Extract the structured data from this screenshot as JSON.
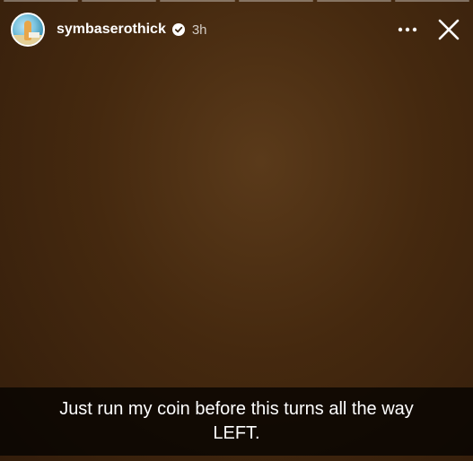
{
  "story": {
    "progress_segments_total": 6,
    "progress_segments_viewed": 0,
    "background_color": "#45290f"
  },
  "header": {
    "username": "symbaserothick",
    "timestamp": "3h",
    "verified": true,
    "more_icon": "ellipsis-icon",
    "close_icon": "close-icon"
  },
  "caption": {
    "text": "Just run my coin before this turns all the way\nLEFT."
  }
}
